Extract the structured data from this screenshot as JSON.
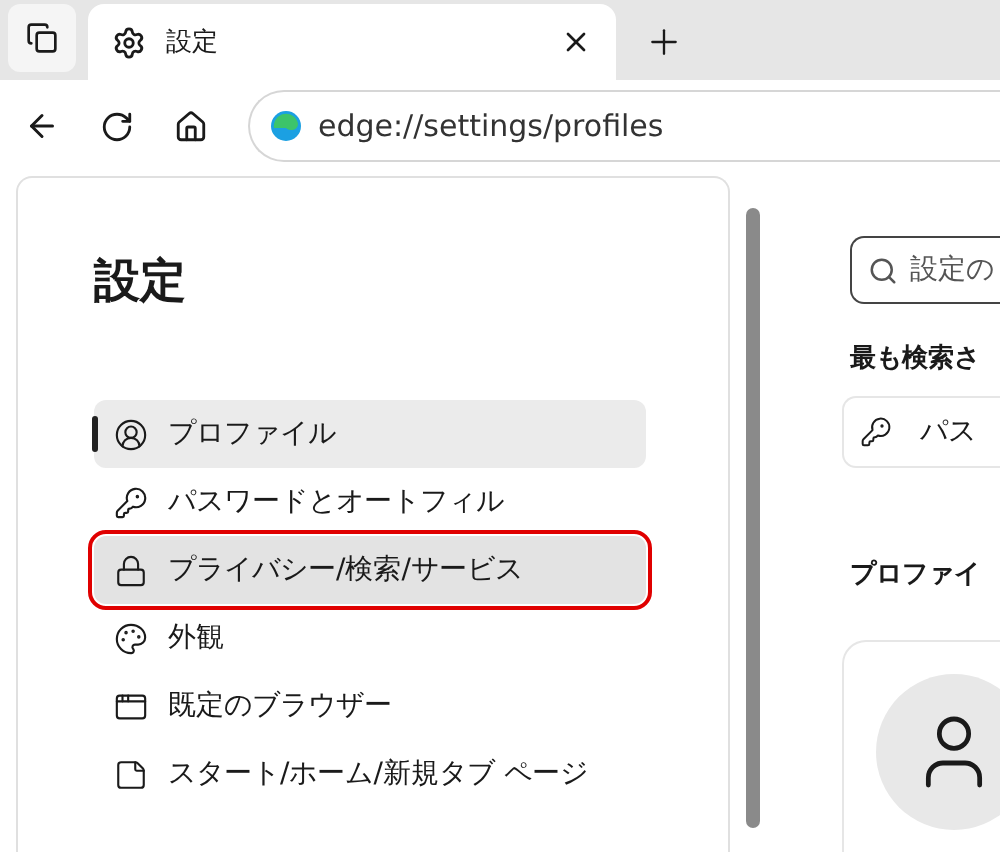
{
  "tab": {
    "title": "設定",
    "selected": true
  },
  "address_bar": {
    "url": "edge://settings/profiles"
  },
  "sidebar": {
    "title": "設定",
    "items": [
      {
        "label": "プロファイル",
        "selected": true,
        "highlighted": false
      },
      {
        "label": "パスワードとオートフィル",
        "selected": false,
        "highlighted": false
      },
      {
        "label": "プライバシー/検索/サービス",
        "selected": false,
        "highlighted": true
      },
      {
        "label": "外観",
        "selected": false,
        "highlighted": false
      },
      {
        "label": "既定のブラウザー",
        "selected": false,
        "highlighted": false
      },
      {
        "label": "スタート/ホーム/新規タブ ページ",
        "selected": false,
        "highlighted": false
      }
    ]
  },
  "main": {
    "search": {
      "placeholder": "設定の"
    },
    "top_searched": {
      "heading": "最も検索さ",
      "chip": "パス"
    },
    "profiles": {
      "heading": "プロファイ"
    }
  }
}
